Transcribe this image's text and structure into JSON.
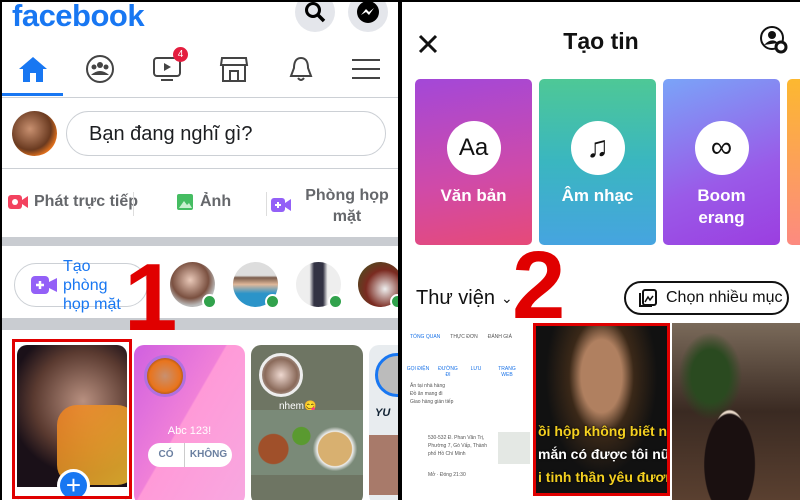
{
  "left": {
    "logo": "facebook",
    "icons": {
      "search": "search-icon",
      "messenger": "messenger-icon"
    },
    "nav": {
      "watch_badge": "4",
      "tabs": [
        "home",
        "groups",
        "watch",
        "marketplace",
        "notifications",
        "menu"
      ]
    },
    "composer": {
      "placeholder": "Bạn đang nghĩ gì?"
    },
    "actions": [
      {
        "label": "Phát trực tiếp",
        "color": "#f3425f"
      },
      {
        "label": "Ảnh",
        "color": "#45bd62"
      },
      {
        "label": "Phòng họp mặt",
        "color": "#9360f7"
      }
    ],
    "rooms": {
      "create_label": "Tạo phòng họp mặt"
    },
    "stories": {
      "poll_text": "Abc 123!",
      "poll_yes": "CÓ",
      "poll_no": "KHÔNG",
      "caption": "nhem😋",
      "partial": "YU"
    },
    "step": "1"
  },
  "right": {
    "title": "Tạo tin",
    "cards": [
      {
        "icon": "Aa",
        "label": "Văn bản"
      },
      {
        "icon": "♫",
        "label": "Âm nhạc"
      },
      {
        "icon": "∞",
        "label": "Boom erang"
      }
    ],
    "gallery_label": "Thư viện",
    "multi_select": "Chọn nhiều mục",
    "gallery": {
      "map_tabs": [
        "TỔNG QUAN",
        "THỰC ĐƠN",
        "ĐÁNH GIÁ"
      ],
      "map_actions": [
        "GỌI ĐIỆN",
        "ĐƯỜNG ĐI",
        "LƯU",
        "TRANG WEB"
      ],
      "map_features": [
        "Ăn tại nhà hàng",
        "Đồ ăn mang đi",
        "Giao hàng gián tiếp"
      ],
      "map_address": "530-532 Đ. Phan Văn Trị, Phường 7, Gò Vấp, Thành phố Hồ Chí Minh",
      "map_hours": "Mở · Đóng 21:30",
      "meme_lines": [
        "ồi hộp không biết năm",
        "mắn có được tôi nữa.",
        "i tinh thần yêu đương"
      ]
    },
    "step": "2"
  },
  "colors": {
    "brand": "#1877f2",
    "highlight": "#e00000"
  }
}
